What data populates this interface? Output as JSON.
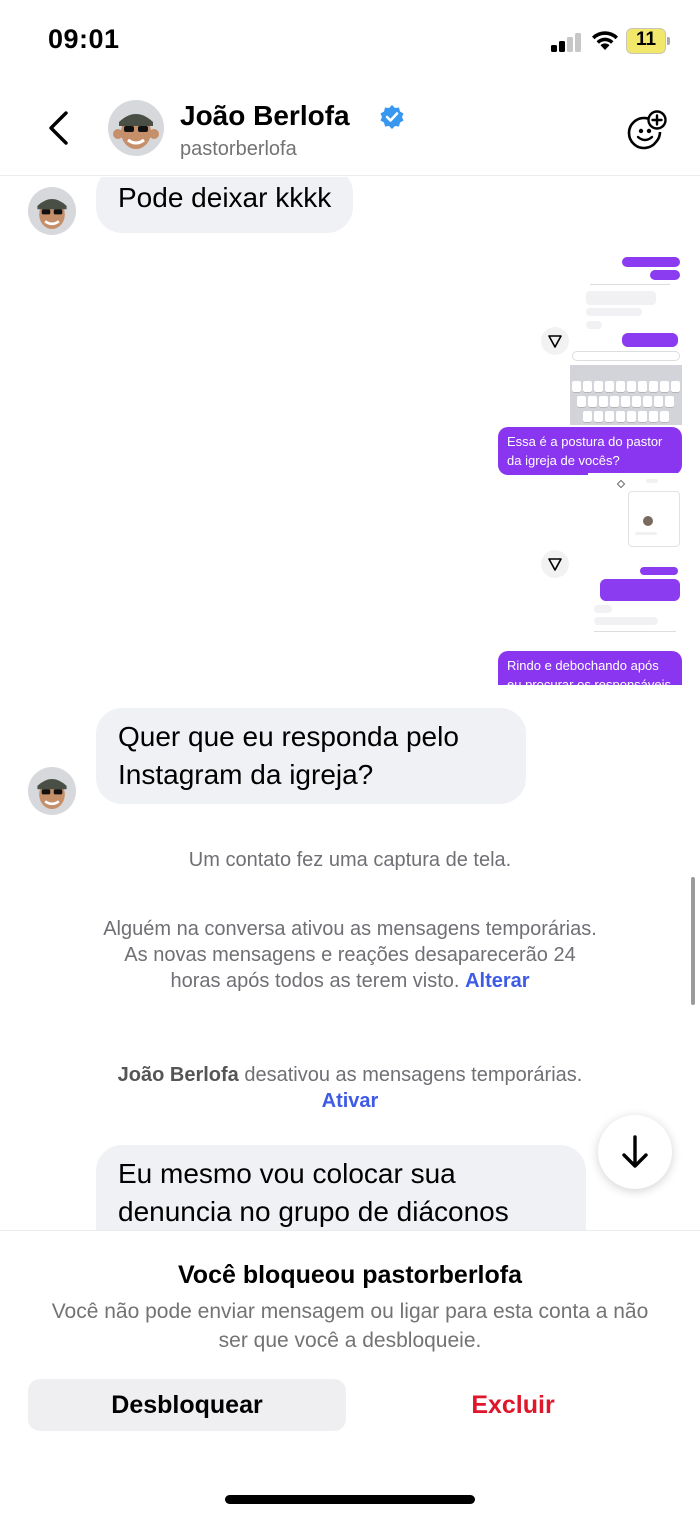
{
  "status_bar": {
    "time": "09:01",
    "battery": "11"
  },
  "header": {
    "name": "João Berlofa",
    "username": "pastorberlofa",
    "icons": [
      "back-chevron-icon",
      "verified-badge-icon",
      "sticker-add-icon"
    ]
  },
  "messages": {
    "msg1": "Pode deixar kkkk",
    "msg2": "Quer que eu responda pelo Instagram da igreja?",
    "msg3": "Eu mesmo vou colocar sua denuncia no grupo de diáconos"
  },
  "screenshot1": {
    "bubble_caption": "Essa é a postura do pastor da igreja de vocês?"
  },
  "screenshot2": {
    "bubble_caption": "Rindo e debochando após eu procurar os responsáveis da"
  },
  "system": {
    "screenshot_notice": "Um contato fez uma captura de tela.",
    "vanish_on": "Alguém na conversa ativou as mensagens temporárias. As novas mensagens e reações desaparecerão 24 horas após todos as terem visto.",
    "vanish_on_link": "Alterar",
    "vanish_off_name": "João Berlofa",
    "vanish_off_text": "desativou as mensagens temporárias.",
    "vanish_off_link": "Ativar"
  },
  "footer": {
    "title": "Você bloqueou pastorberlofa",
    "description": "Você não pode enviar mensagem ou ligar para esta conta a não ser que você a desbloqueie.",
    "unblock_label": "Desbloquear",
    "delete_label": "Excluir"
  },
  "colors": {
    "accent_blue": "#3e5be6",
    "danger_red": "#e0162b",
    "bubble_gray": "#f0f1f4",
    "purple": "#8a35ef"
  }
}
